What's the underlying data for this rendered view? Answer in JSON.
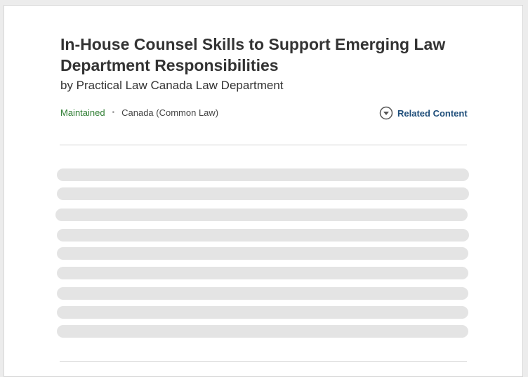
{
  "document": {
    "title": "In-House Counsel Skills to Support Emerging Law Department Responsibilities",
    "author": "by Practical Law Canada Law Department",
    "status": "Maintained",
    "separator": "•",
    "jurisdiction": "Canada (Common Law)",
    "related_content_label": "Related Content",
    "related_icon": "chevron-down-circle-icon"
  },
  "colors": {
    "status": "#2e7d32",
    "link": "#1f4e7a",
    "skeleton": "#e4e4e4"
  },
  "loading_placeholder_lines": 9
}
